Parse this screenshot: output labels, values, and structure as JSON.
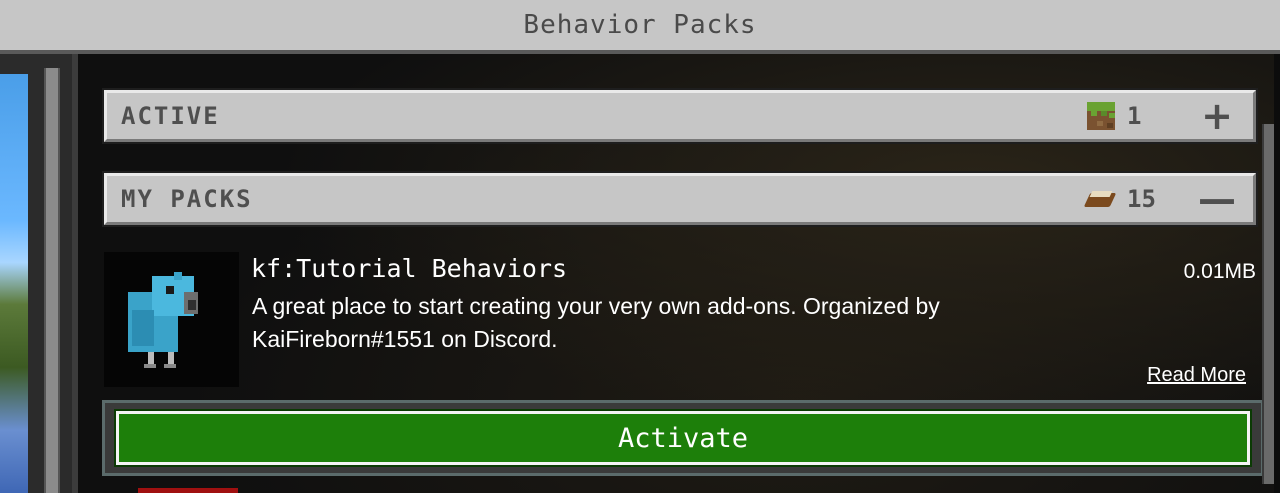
{
  "window": {
    "title": "Behavior Packs"
  },
  "sections": {
    "active": {
      "label": "ACTIVE",
      "count": "1",
      "icon": "grass-block-icon",
      "action": "+"
    },
    "my_packs": {
      "label": "MY PACKS",
      "count": "15",
      "icon": "book-icon",
      "action": "—"
    }
  },
  "pack": {
    "name": "kf:Tutorial Behaviors",
    "description": "A great place to start creating your very own add-ons. Organized by KaiFireborn#1551 on Discord.",
    "size": "0.01MB",
    "read_more": "Read More"
  },
  "buttons": {
    "activate": "Activate"
  },
  "colors": {
    "activate_green": "#1d7f0a",
    "panel_gray": "#c6c6c6"
  }
}
